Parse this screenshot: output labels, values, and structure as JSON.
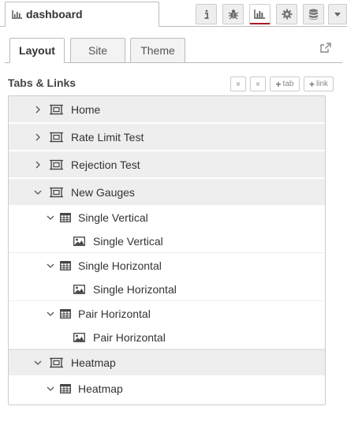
{
  "header": {
    "tab_label": "dashboard",
    "tab_icon": "bar-chart-icon",
    "buttons": [
      "info-icon",
      "bug-icon",
      "bar-chart-icon",
      "gear-icon",
      "database-icon",
      "caret-down-icon"
    ]
  },
  "subtabs": [
    "Layout",
    "Site",
    "Theme"
  ],
  "section": {
    "title": "Tabs & Links",
    "buttons": {
      "collapse": "«",
      "expand": "»",
      "add_tab": "tab",
      "add_link": "link"
    }
  },
  "tree": [
    {
      "type": "tab",
      "label": "Home",
      "expanded": false
    },
    {
      "type": "tab",
      "label": "Rate Limit Test",
      "expanded": false
    },
    {
      "type": "tab",
      "label": "Rejection Test",
      "expanded": false
    },
    {
      "type": "tab",
      "label": "New Gauges",
      "expanded": true
    },
    {
      "type": "group",
      "label": "Single Vertical",
      "expanded": true
    },
    {
      "type": "widget",
      "label": "Single Vertical"
    },
    {
      "type": "group",
      "label": "Single Horizontal",
      "expanded": true
    },
    {
      "type": "widget",
      "label": "Single Horizontal"
    },
    {
      "type": "group",
      "label": "Pair Horizontal",
      "expanded": true
    },
    {
      "type": "widget",
      "label": "Pair Horizontal"
    },
    {
      "type": "tab",
      "label": "Heatmap",
      "expanded": true
    },
    {
      "type": "group",
      "label": "Heatmap",
      "expanded": true
    }
  ],
  "colors": {
    "accent": "#ad1625",
    "tab_row_bg": "#eeeeee",
    "border": "#cccccc"
  }
}
